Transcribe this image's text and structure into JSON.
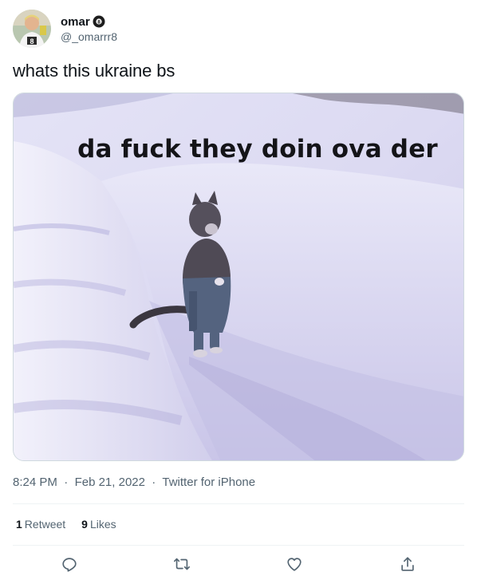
{
  "author": {
    "display_name": "omar",
    "handle": "@_omarrr8",
    "badge_icon": "pool-8-ball-icon"
  },
  "tweet": {
    "text": "whats this ukraine bs",
    "media": {
      "caption": "da fuck they doin ova der"
    }
  },
  "meta": {
    "time": "8:24 PM",
    "date": "Feb 21, 2022",
    "source": "Twitter for iPhone",
    "separator": "·"
  },
  "stats": {
    "retweets_count": "1",
    "retweets_label": "Retweet",
    "likes_count": "9",
    "likes_label": "Likes"
  },
  "actions": {
    "reply_icon": "reply-icon",
    "retweet_icon": "retweet-icon",
    "like_icon": "heart-icon",
    "share_icon": "share-icon"
  },
  "colors": {
    "text_primary": "#0f1419",
    "text_secondary": "#536471",
    "divider": "#eff3f4",
    "snow": "#ebeaf8"
  }
}
